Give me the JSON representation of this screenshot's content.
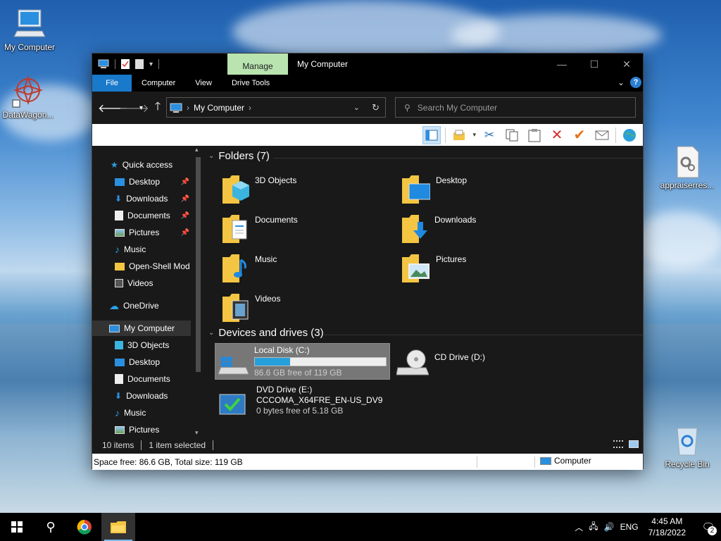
{
  "desktop": {
    "icons": [
      {
        "label": "My Computer"
      },
      {
        "label": "DataWagon..."
      },
      {
        "label": "appraiserres..."
      },
      {
        "label": "Recycle Bin"
      }
    ]
  },
  "window": {
    "title": "My Computer",
    "context_tab": "Manage",
    "ribbon_tabs": [
      "File",
      "Computer",
      "View",
      "Drive Tools"
    ],
    "address": {
      "path": "My Computer"
    },
    "search": {
      "placeholder": "Search My Computer"
    }
  },
  "nav": {
    "items": [
      {
        "label": "Quick access",
        "icon": "star-icon"
      },
      {
        "label": "Desktop",
        "icon": "desktop-icon",
        "pinned": true
      },
      {
        "label": "Downloads",
        "icon": "download-icon",
        "pinned": true
      },
      {
        "label": "Documents",
        "icon": "document-icon",
        "pinned": true
      },
      {
        "label": "Pictures",
        "icon": "picture-icon",
        "pinned": true
      },
      {
        "label": "Music",
        "icon": "music-icon"
      },
      {
        "label": "Open-Shell Mod",
        "icon": "folder-icon"
      },
      {
        "label": "Videos",
        "icon": "video-icon"
      },
      {
        "label": "OneDrive",
        "icon": "cloud-icon"
      },
      {
        "label": "My Computer",
        "icon": "computer-icon"
      },
      {
        "label": "3D Objects",
        "icon": "cube-icon"
      },
      {
        "label": "Desktop",
        "icon": "desktop-icon"
      },
      {
        "label": "Documents",
        "icon": "document-icon"
      },
      {
        "label": "Downloads",
        "icon": "download-icon"
      },
      {
        "label": "Music",
        "icon": "music-icon"
      },
      {
        "label": "Pictures",
        "icon": "picture-icon"
      }
    ]
  },
  "content": {
    "folders_header": "Folders (7)",
    "folders": [
      {
        "label": "3D Objects"
      },
      {
        "label": "Desktop"
      },
      {
        "label": "Documents"
      },
      {
        "label": "Downloads"
      },
      {
        "label": "Music"
      },
      {
        "label": "Pictures"
      },
      {
        "label": "Videos"
      }
    ],
    "drives_header": "Devices and drives (3)",
    "drives": [
      {
        "name": "Local Disk (C:)",
        "free": "86.6 GB free of 119 GB",
        "used_fraction": 0.27
      },
      {
        "name": "CD Drive (D:)"
      },
      {
        "name": "DVD Drive (E:)",
        "label": "CCCOMA_X64FRE_EN-US_DV9",
        "free": "0 bytes free of 5.18 GB"
      }
    ]
  },
  "status": {
    "items_count": "10 items",
    "selected": "1 item selected"
  },
  "infobar": {
    "space": "Space free: 86.6 GB, Total size: 119 GB",
    "zone": "Computer"
  },
  "taskbar": {
    "lang": "ENG",
    "time": "4:45 AM",
    "date": "7/18/2022",
    "notifications": "2"
  },
  "colors": {
    "accent": "#1979ca",
    "context_tab": "#b9e4b0",
    "drive_fill": "#26a0da"
  }
}
